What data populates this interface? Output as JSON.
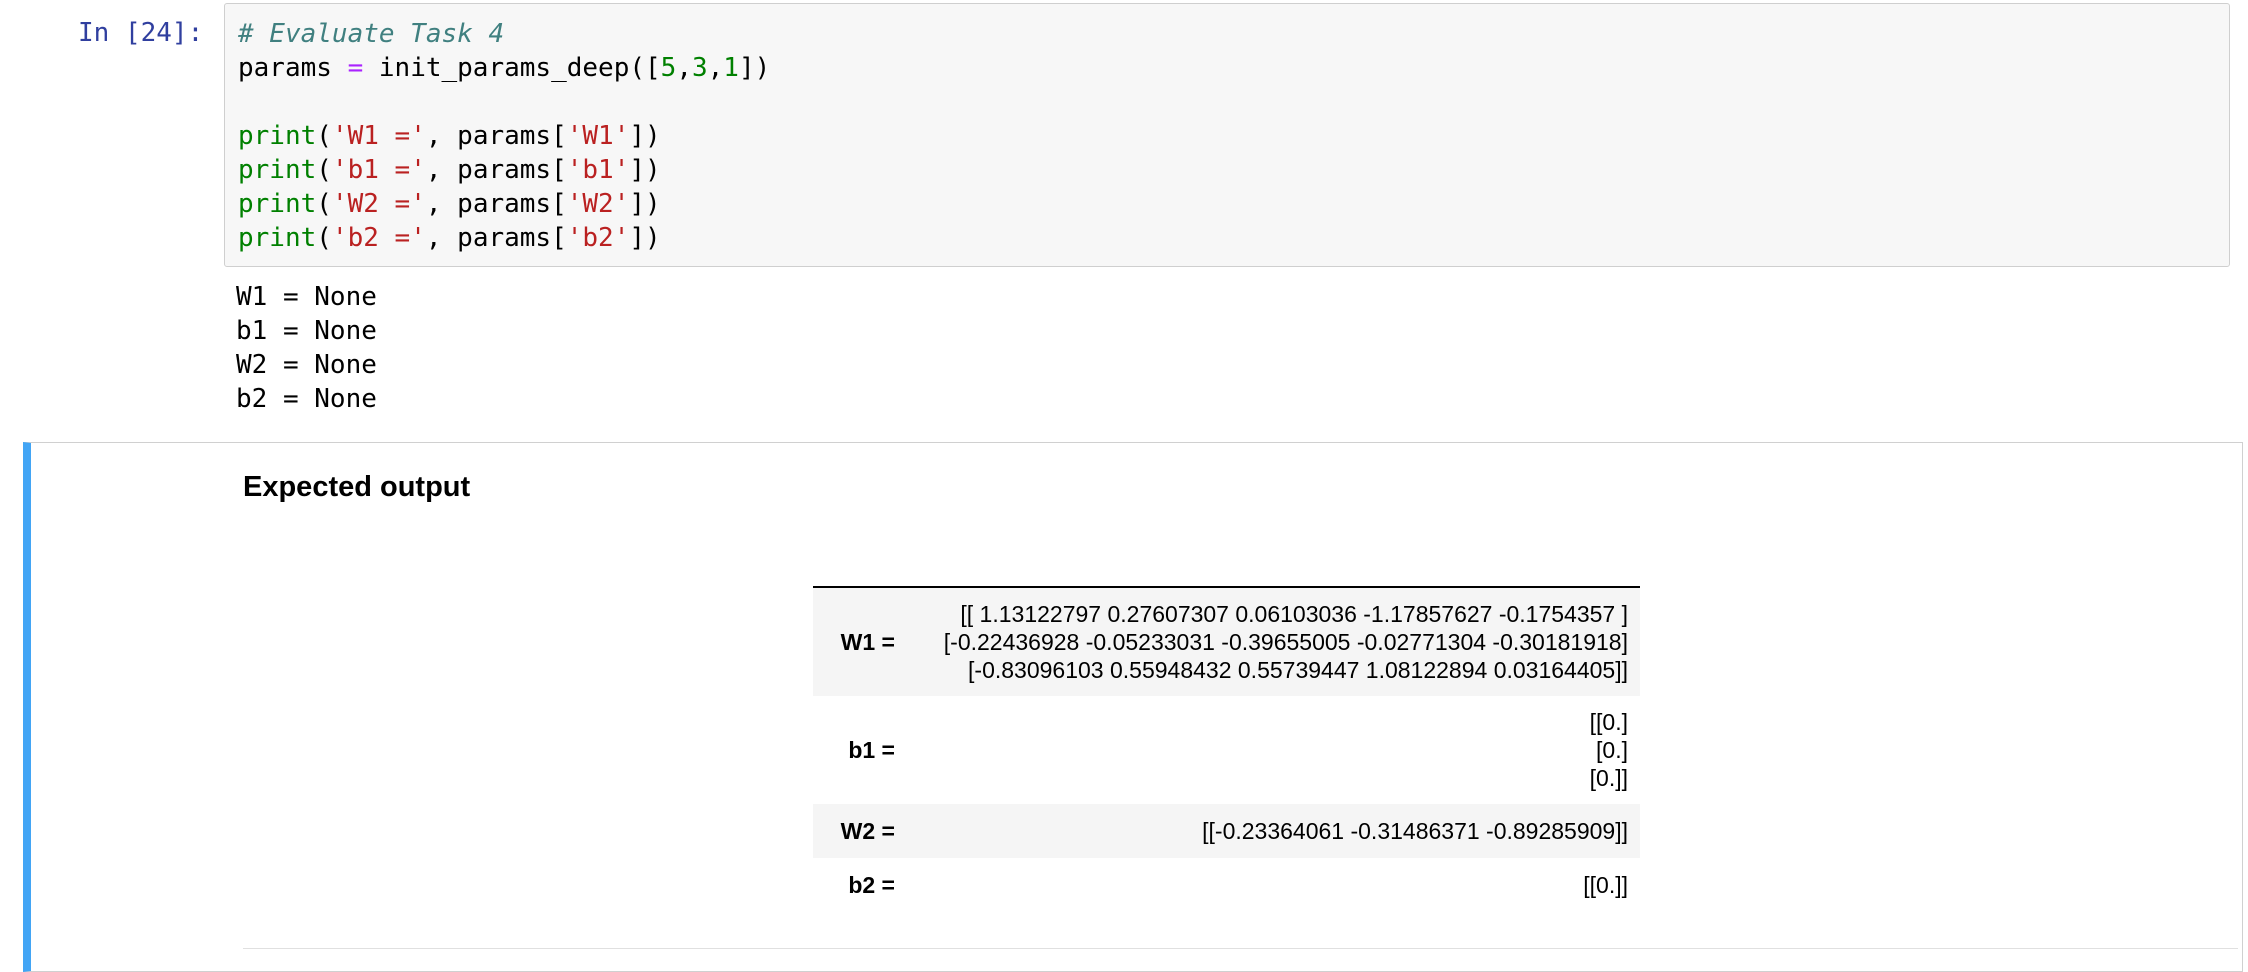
{
  "code_cell": {
    "prompt": "In [24]:",
    "comment": "# Evaluate Task 4",
    "line2": {
      "var": "params",
      "op": "=",
      "func": "init_params_deep([",
      "n1": "5",
      "n2": "3",
      "n3": "1",
      "close": "])"
    },
    "print_fn": "print",
    "print_lines": [
      {
        "label": "'W1 ='",
        "mid": ", params[",
        "key": "'W1'",
        "end": "])"
      },
      {
        "label": "'b1 ='",
        "mid": ", params[",
        "key": "'b1'",
        "end": "])"
      },
      {
        "label": "'W2 ='",
        "mid": ", params[",
        "key": "'W2'",
        "end": "])"
      },
      {
        "label": "'b2 ='",
        "mid": ", params[",
        "key": "'b2'",
        "end": "])"
      }
    ],
    "output_lines": [
      "W1 = None",
      "b1 = None",
      "W2 = None",
      "b2 = None"
    ]
  },
  "markdown_cell": {
    "title": "Expected output",
    "rows": [
      {
        "key": "W1 =",
        "values": [
          "[[ 1.13122797 0.27607307 0.06103036 -1.17857627 -0.1754357 ]",
          "[-0.22436928 -0.05233031 -0.39655005 -0.02771304 -0.30181918]",
          "[-0.83096103 0.55948432 0.55739447 1.08122894 0.03164405]]"
        ]
      },
      {
        "key": "b1 =",
        "values": [
          "[[0.]",
          "[0.]",
          "[0.]]"
        ]
      },
      {
        "key": "W2 =",
        "values": [
          "[[-0.23364061 -0.31486371 -0.89285909]]"
        ]
      },
      {
        "key": "b2 =",
        "values": [
          "[[0.]]"
        ]
      }
    ]
  },
  "colors": {
    "prompt": "#303f9f",
    "comment": "#408080",
    "operator": "#aa22ff",
    "number": "#008000",
    "builtin": "#008000",
    "string": "#ba2121",
    "markdown_accent": "#42a5f5",
    "input_bg": "#f7f7f7"
  }
}
